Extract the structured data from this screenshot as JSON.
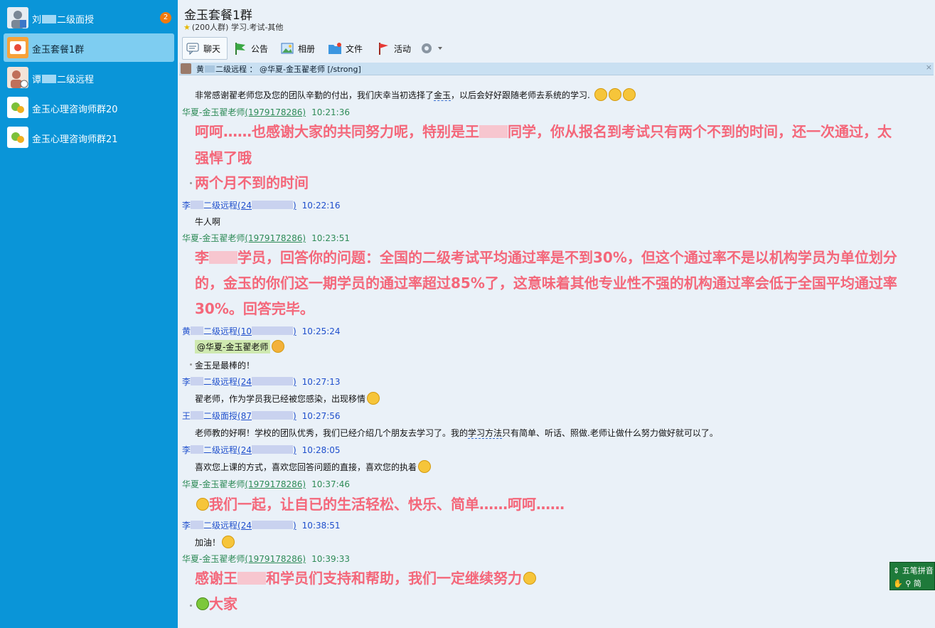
{
  "sidebar": {
    "items": [
      {
        "name_pre": "刘",
        "name_post": "二级面授",
        "badge": "2"
      },
      {
        "name": "金玉套餐1群"
      },
      {
        "name_pre": "谭",
        "name_post": "二级远程"
      },
      {
        "name": "金玉心理咨询师群20"
      },
      {
        "name": "金玉心理咨询师群21"
      }
    ]
  },
  "group": {
    "title": "金玉套餐1群",
    "subtitle": "(200人群) 学习.考试-其他"
  },
  "toolbar": {
    "chat": "聊天",
    "notice": "公告",
    "album": "相册",
    "files": "文件",
    "activity": "活动"
  },
  "pinned": {
    "name_pre": "黄",
    "text": "二级远程 ： @华夏-金玉翟老师 [/strong]",
    "close": "×"
  },
  "messages": {
    "m1": {
      "text_pre": "非常感谢翟老师您及您的团队辛勤的付出，我们庆幸当初选择了",
      "text_link": "金玉",
      "text_post": "，以后会好好跟随老师去系统的学习."
    },
    "h2": {
      "sender": "华夏-金玉翟老师",
      "uid": "(1979178286)",
      "time": "10:21:36"
    },
    "m2": {
      "line1_pre": "呵呵……也感谢大家的共同努力呢，特别是王",
      "line1_post": "同学，你从报名到考试只有两个不到的时间，还一次通过，太",
      "line2": "强悍了哦",
      "line3": "两个月不到的时间"
    },
    "h3": {
      "sender_pre": "李",
      "sender_post": "二级远程",
      "uid_pre": "(24",
      "uid_post": ")",
      "time": "10:22:16"
    },
    "m3": {
      "text": "牛人啊"
    },
    "h4": {
      "sender": "华夏-金玉翟老师",
      "uid": "(1979178286)",
      "time": "10:23:51"
    },
    "m4": {
      "line1_pre": "李",
      "line1_post": "学员，回答你的问题：全国的二级考试平均通过率是不到30%，但这个通过率不是以机构学员为单位划分",
      "line2": "的，金玉的你们这一期学员的通过率超过85%了，这意味着其他专业性不强的机构通过率会低于全国平均通过率",
      "line3": "30%。回答完毕。"
    },
    "h5": {
      "sender_pre": "黄",
      "sender_post": "二级远程",
      "uid_pre": "(10",
      "uid_post": ")",
      "time": "10:25:24"
    },
    "m5": {
      "mention": "@华夏-金玉翟老师",
      "text": "金玉是最棒的！"
    },
    "h6": {
      "sender_pre": "李",
      "sender_post": "二级远程",
      "uid_pre": "(24",
      "uid_post": ")",
      "time": "10:27:13"
    },
    "m6": {
      "text": "翟老师，作为学员我已经被您感染，出现移情"
    },
    "h7": {
      "sender_pre": "王",
      "sender_post": "二级面授",
      "uid_pre": "(87",
      "uid_post": ")",
      "time": "10:27:56"
    },
    "m7": {
      "text_pre": "老师教的好啊！学校的团队优秀，我们已经介绍几个朋友去学习了。我的",
      "text_link": "学习方法",
      "text_post": "只有简单、听话、照做.老师让做什么努力做好就可以了。"
    },
    "h8": {
      "sender_pre": "李",
      "sender_post": "二级远程",
      "uid_pre": "(24",
      "uid_post": ")",
      "time": "10:28:05"
    },
    "m8": {
      "text": "喜欢您上课的方式，喜欢您回答问题的直接，喜欢您的执着"
    },
    "h9": {
      "sender": "华夏-金玉翟老师",
      "uid": "(1979178286)",
      "time": "10:37:46"
    },
    "m9": {
      "text": "我们一起，让自已的生活轻松、快乐、简单……呵呵……"
    },
    "h10": {
      "sender_pre": "李",
      "sender_post": "二级远程",
      "uid_pre": "(24",
      "uid_post": ")",
      "time": "10:38:51"
    },
    "m10": {
      "text": "加油！"
    },
    "h11": {
      "sender": "华夏-金玉翟老师",
      "uid": "(1979178286)",
      "time": "10:39:33"
    },
    "m11": {
      "line1_pre": "感谢王",
      "line1_post": "和学员们支持和帮助，我们一定继续努力",
      "line2": "大家"
    }
  },
  "ime": {
    "line1": "五笔拼音",
    "line2": "简"
  },
  "colors": {
    "sidebar": "#0a95d8",
    "active_item": "#7ecdf1",
    "badge": "#f07a0e",
    "teacher": "#2e8b57",
    "student": "#1f4fcc",
    "big_text": "#f4677a"
  }
}
